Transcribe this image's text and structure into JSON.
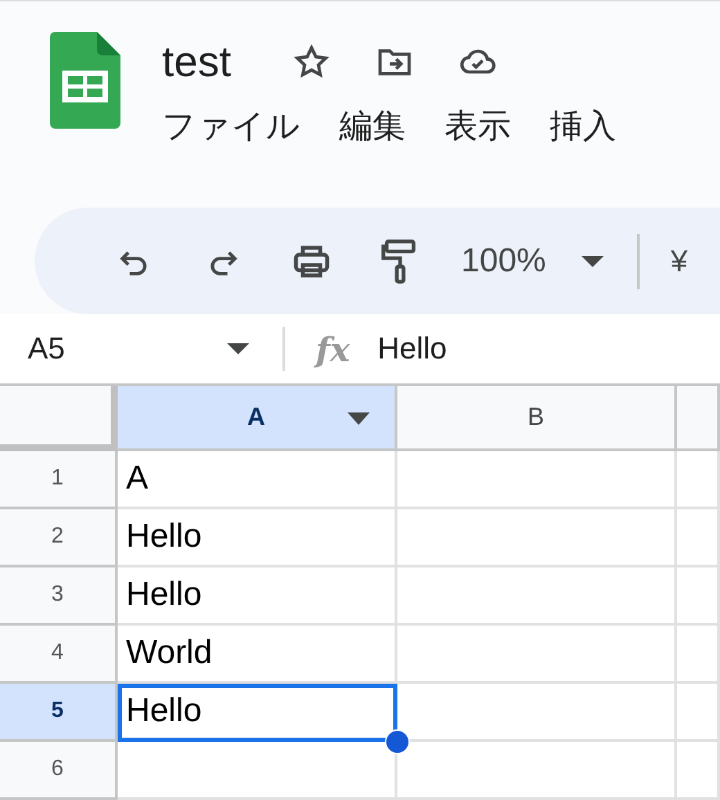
{
  "document": {
    "title": "test"
  },
  "menu": [
    {
      "label": "ファイル"
    },
    {
      "label": "編集"
    },
    {
      "label": "表示"
    },
    {
      "label": "挿入"
    }
  ],
  "toolbar": {
    "zoom": "100%",
    "currency": "¥"
  },
  "formula_bar": {
    "name_box": "A5",
    "fx": "fx",
    "value": "Hello"
  },
  "columns": [
    {
      "label": "A",
      "selected": true
    },
    {
      "label": "B",
      "selected": false
    },
    {
      "selected": false
    }
  ],
  "rows": [
    {
      "number": "1",
      "selected": false,
      "value": "A"
    },
    {
      "number": "2",
      "selected": false,
      "value": "Hello"
    },
    {
      "number": "3",
      "selected": false,
      "value": "Hello"
    },
    {
      "number": "4",
      "selected": false,
      "value": "World"
    },
    {
      "number": "5",
      "selected": true,
      "value": "Hello"
    },
    {
      "number": "6",
      "selected": false
    }
  ]
}
